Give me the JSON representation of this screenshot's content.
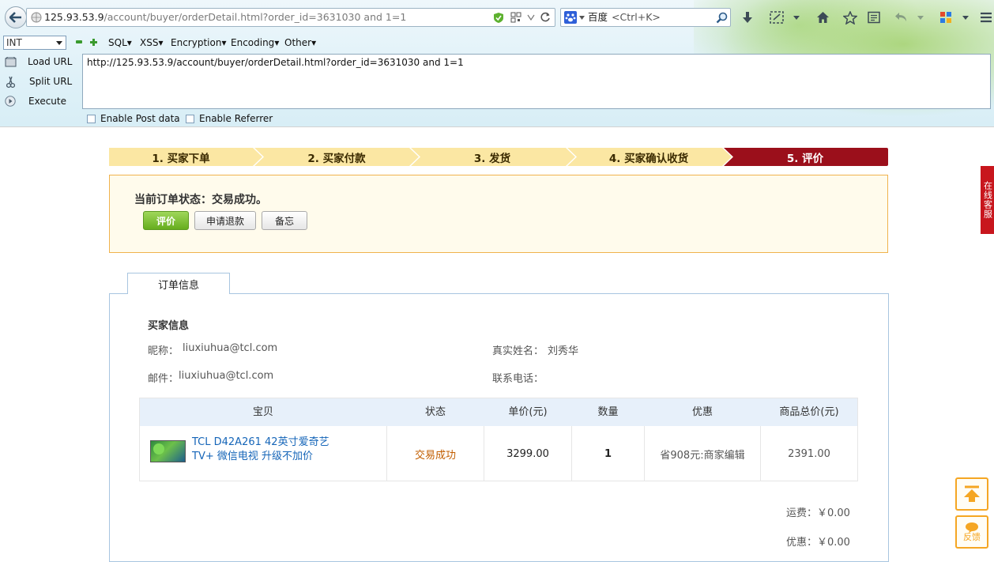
{
  "browser": {
    "url_host": "125.93.53.9",
    "url_rest": "/account/buyer/orderDetail.html?order_id=3631030 and 1=1",
    "search_engine": "百度",
    "search_placeholder": "<Ctrl+K>"
  },
  "hackbar": {
    "type_select": "INT",
    "menus": [
      "SQL",
      "XSS",
      "Encryption",
      "Encoding",
      "Other"
    ],
    "load_url": "Load URL",
    "split_url": "Split URL",
    "execute": "Execute",
    "url_value": "http://125.93.53.9/account/buyer/orderDetail.html?order_id=3631030 and 1=1",
    "enable_post": "Enable Post data",
    "enable_referrer": "Enable Referrer"
  },
  "steps": [
    "1. 买家下单",
    "2. 买家付款",
    "3. 发货",
    "4. 买家确认收货",
    "5. 评价"
  ],
  "order_status": {
    "text": "当前订单状态：交易成功。",
    "btn_review": "评价",
    "btn_refund": "申请退款",
    "btn_memo": "备忘"
  },
  "tab_label": "订单信息",
  "buyer": {
    "section_title": "买家信息",
    "nickname_label": "昵称：",
    "nickname": "liuxiuhua@tcl.com",
    "realname_label": "真实姓名：",
    "realname": "刘秀华",
    "email_label": "邮件：",
    "email": "liuxiuhua@tcl.com",
    "phone_label": "联系电话："
  },
  "table": {
    "headers": [
      "宝贝",
      "状态",
      "单价(元)",
      "数量",
      "优惠",
      "商品总价(元)"
    ],
    "row": {
      "product_line1": "TCL D42A261 42英寸爱奇艺",
      "product_line2": "TV+ 微信电视 升级不加价",
      "status": "交易成功",
      "unit_price": "3299.00",
      "quantity": "1",
      "discount": "省908元:商家编辑",
      "total": "2391.00"
    }
  },
  "fees": {
    "shipping": "运费：￥0.00",
    "discount": "优惠：￥0.00"
  },
  "side": {
    "online_service": "在线客服",
    "feedback": "反馈"
  },
  "colors": {
    "step_bg": "#fbe7a3",
    "step_active": "#9b0f1b",
    "link": "#1565b8",
    "status_orange": "#c25e00"
  }
}
